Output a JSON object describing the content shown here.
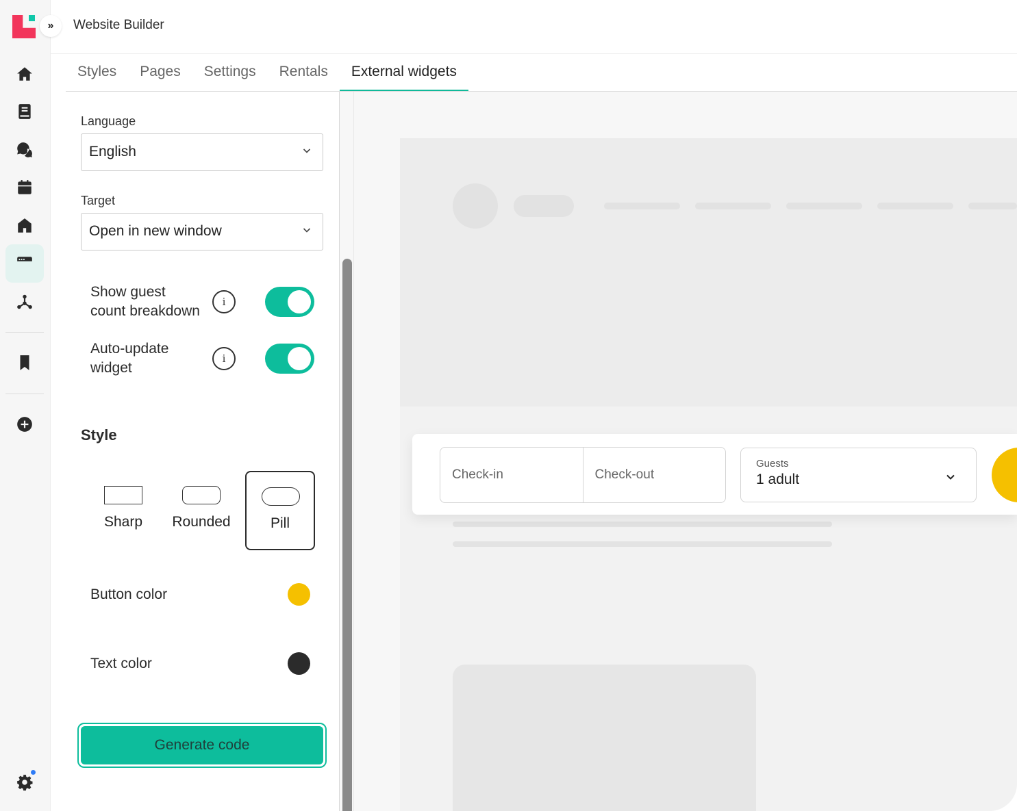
{
  "app": {
    "title": "Website Builder",
    "expand_icon": "»"
  },
  "rail": {
    "items": [
      {
        "icon": "home-icon"
      },
      {
        "icon": "book-icon"
      },
      {
        "icon": "chat-icon"
      },
      {
        "icon": "calendar-icon"
      },
      {
        "icon": "property-icon"
      },
      {
        "icon": "website-icon",
        "active": true
      },
      {
        "icon": "integrations-icon"
      },
      {
        "icon": "bookmark-icon"
      },
      {
        "icon": "add-circle-icon"
      },
      {
        "icon": "gear-icon"
      }
    ],
    "accent": "#10c7a9",
    "logo_colors": [
      "#f2355b",
      "#10c7a9"
    ],
    "notification_color": "#2f7cf6"
  },
  "tabs": [
    {
      "label": "Styles"
    },
    {
      "label": "Pages"
    },
    {
      "label": "Settings"
    },
    {
      "label": "Rentals"
    },
    {
      "label": "External widgets",
      "active": true
    }
  ],
  "settings": {
    "language": {
      "label": "Language",
      "value": "English"
    },
    "target": {
      "label": "Target",
      "value": "Open in new window"
    },
    "toggles": [
      {
        "label_line1": "Show guest",
        "label_line2": "count breakdown",
        "info": "i",
        "on": true
      },
      {
        "label_line1": "Auto-update",
        "label_line2": "widget",
        "info": "i",
        "on": true
      }
    ],
    "style": {
      "heading": "Style",
      "options": [
        {
          "label": "Sharp",
          "selected": false
        },
        {
          "label": "Rounded",
          "selected": false
        },
        {
          "label": "Pill",
          "selected": true
        }
      ]
    },
    "button_color": {
      "label": "Button color",
      "value": "#f5c000"
    },
    "text_color": {
      "label": "Text color",
      "value": "#2b2b2b"
    },
    "generate_button": "Generate code",
    "accent": "#0dbd9c"
  },
  "preview": {
    "checkin": "Check-in",
    "checkout": "Check-out",
    "guests_label": "Guests",
    "guests_value": "1 adult"
  }
}
